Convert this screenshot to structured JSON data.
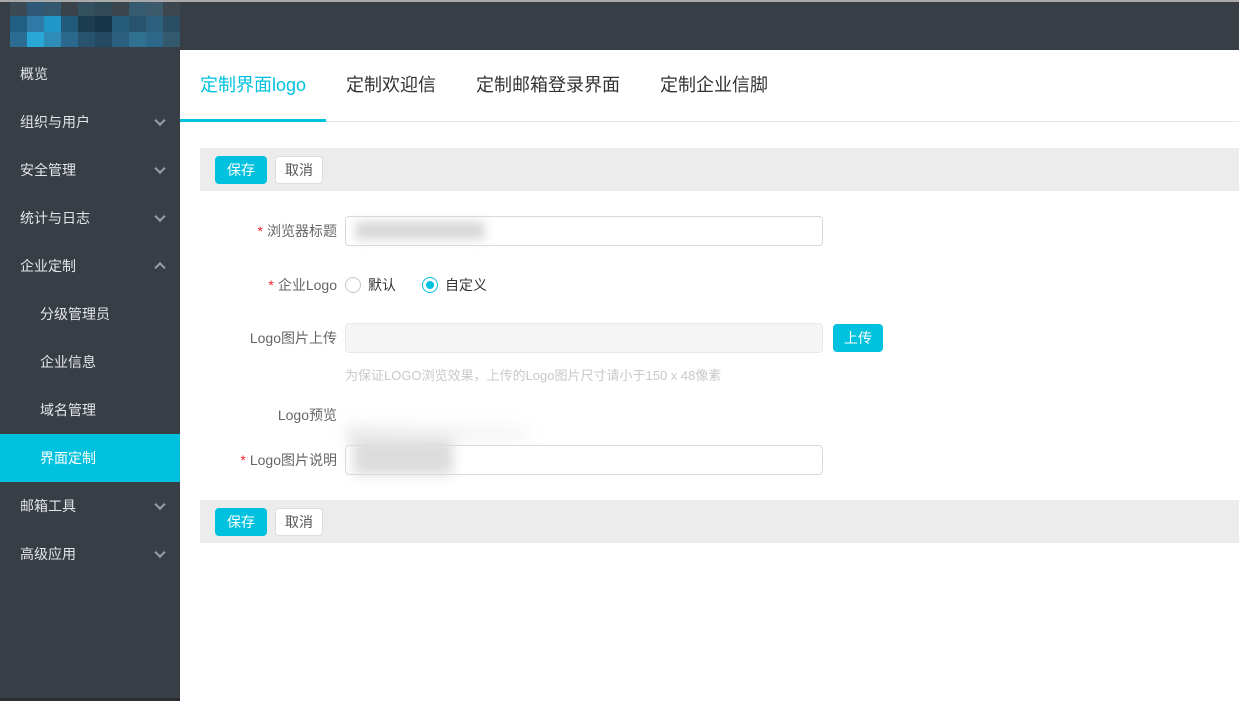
{
  "colors": {
    "accent_cyan": "#00c1de",
    "sidebar_bg": "#383e45",
    "toolbar_bg": "#ececec"
  },
  "sidebar": {
    "logo_mosaic": [
      "#3c4a54",
      "#2e5875",
      "#34596f",
      "#3a4349",
      "#33505f",
      "#304a58",
      "#3a454d",
      "#365a70",
      "#3d5a6c",
      "#3c464e",
      "#205e84",
      "#2f7aa6",
      "#2196c9",
      "#215a7a",
      "#1c3c50",
      "#183448",
      "#245c7a",
      "#28536c",
      "#2d607e",
      "#2a4f65",
      "#2b6c92",
      "#29a7d6",
      "#2f8cb7",
      "#2a688d",
      "#27536c",
      "#234a61",
      "#2a5f80",
      "#307090",
      "#2d688b",
      "#33596f"
    ],
    "items": [
      {
        "label": "概览"
      },
      {
        "label": "组织与用户"
      },
      {
        "label": "安全管理"
      },
      {
        "label": "统计与日志"
      },
      {
        "label": "企业定制"
      },
      {
        "label": "分级管理员"
      },
      {
        "label": "企业信息"
      },
      {
        "label": "域名管理"
      },
      {
        "label": "界面定制"
      },
      {
        "label": "邮箱工具"
      },
      {
        "label": "高级应用"
      }
    ]
  },
  "tabs": [
    {
      "label": "定制界面logo",
      "active": true
    },
    {
      "label": "定制欢迎信",
      "active": false
    },
    {
      "label": "定制邮箱登录界面",
      "active": false
    },
    {
      "label": "定制企业信脚",
      "active": false
    }
  ],
  "actions": {
    "save_label": "保存",
    "cancel_label": "取消"
  },
  "form": {
    "required_marker": "*",
    "browser_title": {
      "label": "浏览器标题"
    },
    "company_logo": {
      "label": "企业Logo",
      "options": [
        {
          "label": "默认",
          "selected": false
        },
        {
          "label": "自定义",
          "selected": true
        }
      ]
    },
    "logo_upload": {
      "label": "Logo图片上传",
      "button_label": "上传",
      "hint": "为保证LOGO浏览效果，上传的Logo图片尺寸请小于150 x 48像素"
    },
    "logo_preview": {
      "label": "Logo预览"
    },
    "logo_description": {
      "label": "Logo图片说明"
    }
  }
}
